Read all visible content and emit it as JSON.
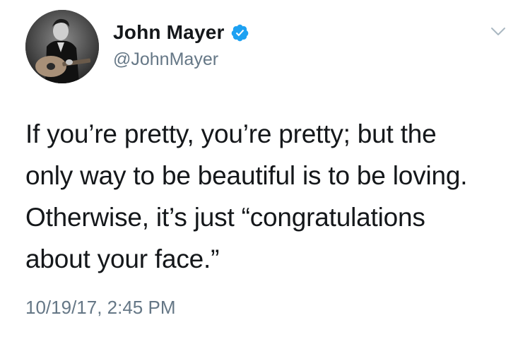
{
  "tweet": {
    "author": {
      "display_name": "John Mayer",
      "handle": "@JohnMayer",
      "verified": true,
      "avatar_icon": "profile-photo-man-with-guitar"
    },
    "text": "If you’re pretty, you’re pretty; but the\nonly way to be beautiful is to be loving.\nOtherwise, it’s just “congratulations\nabout your face.”",
    "timestamp": "10/19/17, 2:45 PM",
    "menu_icon": "chevron-down-icon",
    "colors": {
      "text": "#14171a",
      "secondary": "#657786",
      "verified_badge": "#1da1f2"
    }
  }
}
